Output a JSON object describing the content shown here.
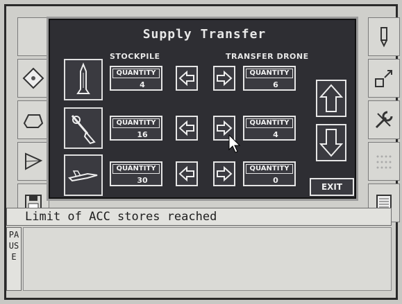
{
  "title": "Supply Transfer",
  "columns": {
    "stockpile": "STOCKPILE",
    "drone": "TRANSFER DRONE"
  },
  "rows": [
    {
      "item_icon": "missile-icon",
      "stock_label": "QUANTITY",
      "stock_qty": "4",
      "drone_label": "QUANTITY",
      "drone_qty": "6"
    },
    {
      "item_icon": "fuel-pump-icon",
      "stock_label": "QUANTITY",
      "stock_qty": "16",
      "drone_label": "QUANTITY",
      "drone_qty": "4"
    },
    {
      "item_icon": "aircraft-icon",
      "stock_label": "QUANTITY",
      "stock_qty": "30",
      "drone_label": "QUANTITY",
      "drone_qty": "0"
    }
  ],
  "exit_label": "EXIT",
  "status_message": "Limit of ACC stores reached",
  "pause_label": "PAUSE",
  "left_tools": [
    "map-diamond-icon",
    "hexagon-prism-icon",
    "triangle-prism-icon",
    "floppy-disk-icon"
  ],
  "right_tools": [
    "pencil-icon",
    "resize-icon",
    "wrench-icon",
    "grid-dots-icon",
    "chip-icon"
  ],
  "colors": {
    "panel": "#2e2e33",
    "panel_text": "#e8e8e8",
    "background": "#cfcfcb"
  }
}
